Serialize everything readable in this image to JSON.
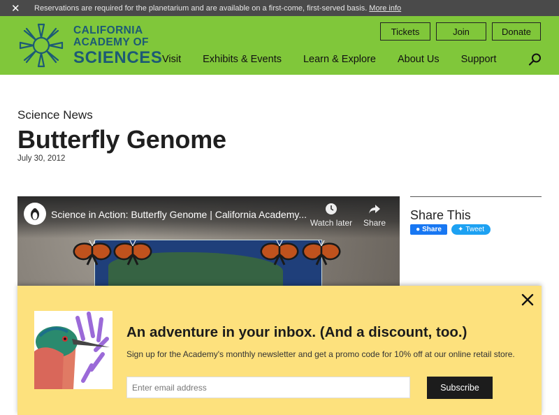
{
  "alert": {
    "close_icon": "close-icon",
    "message": "Reservations are required for the planetarium and are available on a first-come, first-served basis.",
    "link": "More info"
  },
  "header": {
    "logo": {
      "line1": "CALIFORNIA",
      "line2": "ACADEMY OF",
      "line3": "SCIENCES",
      "color": "#1c5a75"
    },
    "background": "#80c73a",
    "buttons": {
      "tickets": "Tickets",
      "join": "Join",
      "donate": "Donate"
    },
    "nav": [
      "Visit",
      "Exhibits & Events",
      "Learn & Explore",
      "About Us",
      "Support"
    ],
    "search_icon": "search-icon"
  },
  "article": {
    "kicker": "Science News",
    "title": "Butterfly Genome",
    "date": "July 30, 2012"
  },
  "video": {
    "title": "Science in Action: Butterfly Genome | California Academy...",
    "watch_later": "Watch later",
    "share": "Share"
  },
  "share": {
    "heading": "Share This",
    "facebook": "Share",
    "twitter": "Tweet"
  },
  "newsletter": {
    "heading": "An adventure in your inbox. (And a discount, too.)",
    "subtext": "Sign up for the Academy's monthly newsletter and get a promo code for 10% off at our online retail store.",
    "email_placeholder": "Enter email address",
    "subscribe": "Subscribe",
    "background": "#fde17d"
  }
}
